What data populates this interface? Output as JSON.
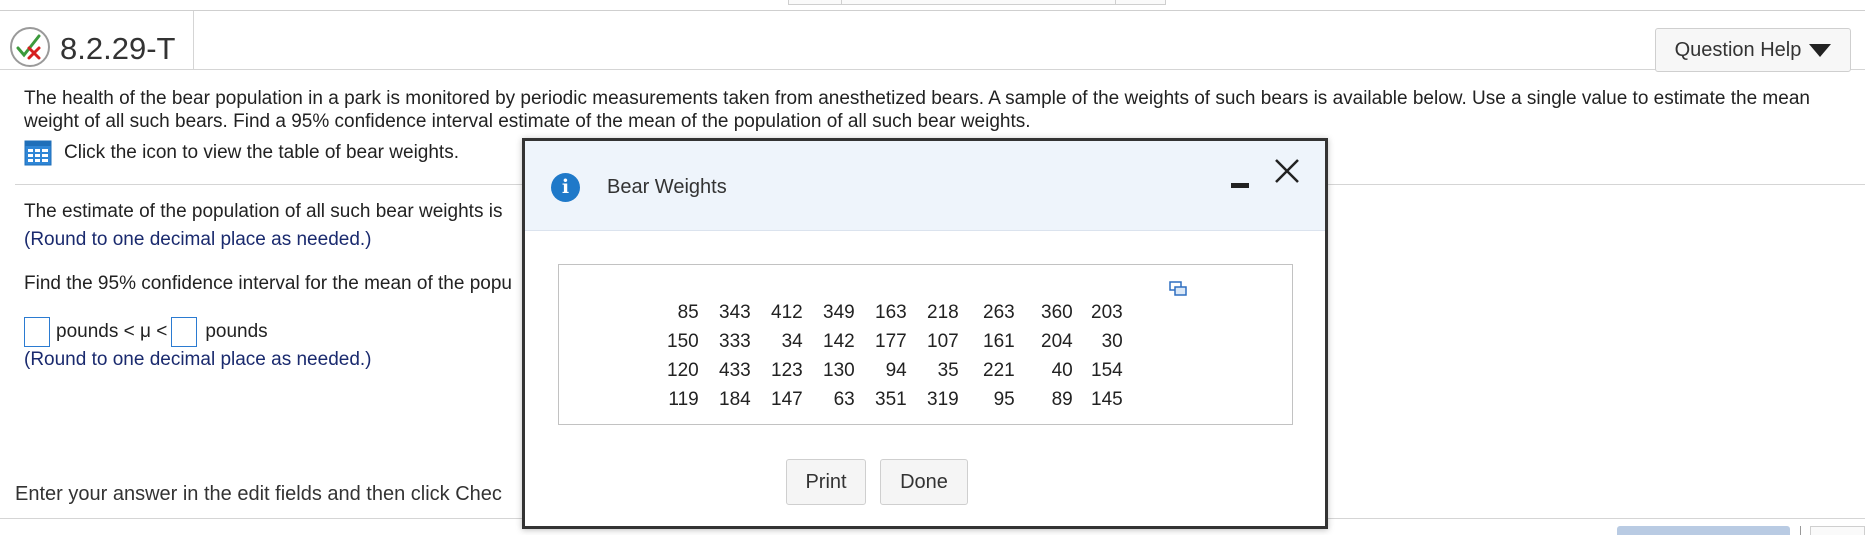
{
  "header": {
    "question_id": "8.2.29-T",
    "help_label": "Question Help"
  },
  "question": {
    "text": "The health of the bear population in a park is monitored by periodic measurements taken from anesthetized bears. A sample of the weights of such bears is available below. Use a single value to estimate the mean weight of all such bears. Find a 95% confidence interval estimate of the mean of the population of all such bear weights.",
    "table_link": "Click the icon to view the table of bear weights."
  },
  "parts": {
    "estimate_prompt": "The estimate of the population of all such bear weights is",
    "round_note_1": "(Round to one decimal place as needed.)",
    "ci_prompt": "Find the 95% confidence interval for the mean of the popu",
    "interval": {
      "left_unit": "pounds < μ <",
      "right_unit": "pounds"
    },
    "round_note_2": "(Round to one decimal place as needed.)"
  },
  "footer": {
    "instruction": "Enter your answer in the edit fields and then click Chec"
  },
  "dialog": {
    "title": "Bear Weights",
    "minimize_symbol": "–",
    "close_symbol": "X",
    "table_rows": [
      [
        "85",
        "343",
        "412",
        "349",
        "163",
        "218",
        "263",
        "360",
        "203"
      ],
      [
        "150",
        "333",
        "34",
        "142",
        "177",
        "107",
        "161",
        "204",
        "30"
      ],
      [
        "120",
        "433",
        "123",
        "130",
        "94",
        "35",
        "221",
        "40",
        "154"
      ],
      [
        "119",
        "184",
        "147",
        "63",
        "351",
        "319",
        "95",
        "89",
        "145"
      ]
    ],
    "print_label": "Print",
    "done_label": "Done"
  },
  "colors": {
    "accent": "#1f79c9",
    "note_text": "#1a2a6e",
    "dialog_header_bg": "#eef4fb"
  }
}
